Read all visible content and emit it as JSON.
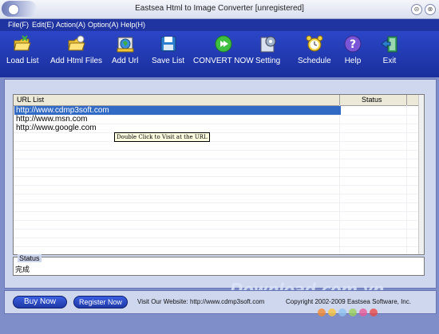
{
  "window": {
    "title": "Eastsea Html to Image Converter [unregistered]"
  },
  "menu": [
    {
      "label": "File(F)"
    },
    {
      "label": "Edit(E)"
    },
    {
      "label": "Action(A)"
    },
    {
      "label": "Option(A)"
    },
    {
      "label": "Help(H)"
    }
  ],
  "toolbar": [
    {
      "label": "Load List",
      "icon": "folder-open-icon"
    },
    {
      "label": "Add Html Files",
      "icon": "folder-add-icon"
    },
    {
      "label": "Add Url",
      "icon": "globe-page-icon"
    },
    {
      "label": "Save List",
      "icon": "floppy-disk-icon"
    },
    {
      "label": "CONVERT NOW",
      "icon": "convert-arrow-icon"
    },
    {
      "label": "Setting",
      "icon": "setting-icon"
    },
    {
      "label": "Schedule",
      "icon": "alarm-clock-icon"
    },
    {
      "label": "Help",
      "icon": "question-icon"
    },
    {
      "label": "Exit",
      "icon": "exit-door-icon"
    }
  ],
  "list": {
    "columns": [
      "URL List",
      "Status"
    ],
    "rows": [
      {
        "url": "http://www.cdmp3soft.com",
        "status": ""
      },
      {
        "url": "http://www.msn.com",
        "status": ""
      },
      {
        "url": "http://www.google.com",
        "status": ""
      }
    ],
    "tooltip": "Double Click to Visit at the URL"
  },
  "status": {
    "label": "Status",
    "text": "完成"
  },
  "footer": {
    "buy_now": "Buy Now",
    "register_now": "Register Now",
    "website": "Visit Our Website: http://www.cdmp3soft.com",
    "copyright": "Copyright 2002-2009 Eastsea Software, Inc."
  },
  "watermark": "Download.com.vn",
  "colors": {
    "toolbar": "#1f34a0",
    "selection": "#316ac5",
    "panel": "#cfd7ef"
  }
}
